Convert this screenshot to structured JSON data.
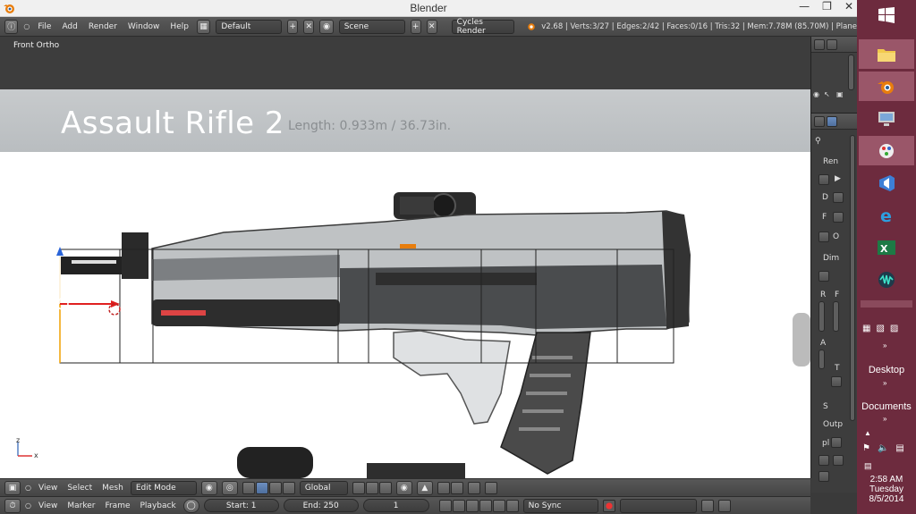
{
  "window": {
    "title": "Blender"
  },
  "info_header": {
    "menus": [
      "File",
      "Add",
      "Render",
      "Window",
      "Help"
    ],
    "screen_layout": "Default",
    "scene": "Scene",
    "render_engine": "Cycles Render",
    "stats": "v2.68 | Verts:3/27 | Edges:2/42 | Faces:0/16 | Tris:32 | Mem:7.78M (85.70M) | Plane"
  },
  "viewport": {
    "label": "Front Ortho",
    "reference_title": "Assault Rifle 2",
    "reference_length": "Length: 0.933m / 36.73in.",
    "axis_z": "z",
    "axis_x": "x"
  },
  "properties_panel": {
    "tabs": [
      "Ren",
      "Dim",
      "S",
      "Outp"
    ],
    "field_labels": [
      "D",
      "F",
      "R",
      "F",
      "A",
      "T",
      "O"
    ],
    "res_label": "pl"
  },
  "edit_header": {
    "menus": [
      "View",
      "Select",
      "Mesh"
    ],
    "mode": "Edit Mode",
    "orientation": "Global"
  },
  "timeline_header": {
    "menus": [
      "View",
      "Marker",
      "Frame",
      "Playback"
    ],
    "start": "Start: 1",
    "end": "End: 250",
    "current": "1",
    "sync": "No Sync"
  },
  "taskbar": {
    "desktop_label": "Desktop",
    "documents_label": "Documents",
    "time": "2:58 AM",
    "day": "Tuesday",
    "date": "8/5/2014"
  },
  "colors": {
    "taskbar_bg": "#6d2b3e",
    "blender_orange": "#e87d0d",
    "accent_blue": "#5680c2"
  }
}
